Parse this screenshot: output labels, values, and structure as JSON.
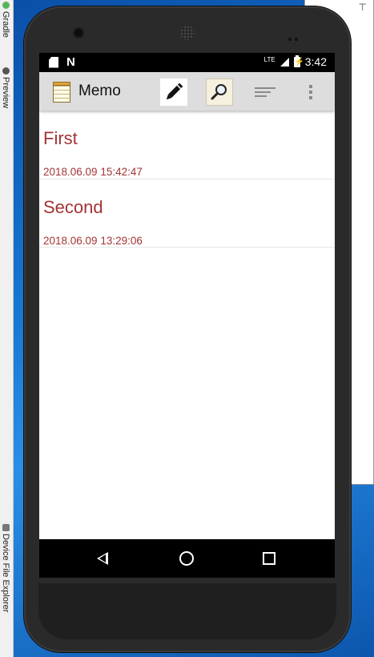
{
  "ide": {
    "tabs": [
      "Gradle",
      "Preview",
      "Device File Explorer"
    ],
    "panel_mark": "⊤"
  },
  "status_bar": {
    "network": "LTE",
    "time": "3:42"
  },
  "action_bar": {
    "title": "Memo",
    "buttons": [
      "pencil-icon",
      "search-icon",
      "sort-icon",
      "more-vert-icon"
    ]
  },
  "memos": [
    {
      "title": "First",
      "date": "2018.06.09 15:42:47"
    },
    {
      "title": "Second",
      "date": "2018.06.09 13:29:06"
    }
  ],
  "colors": {
    "memo_text": "#a33436",
    "action_bar": "#dddddd"
  }
}
